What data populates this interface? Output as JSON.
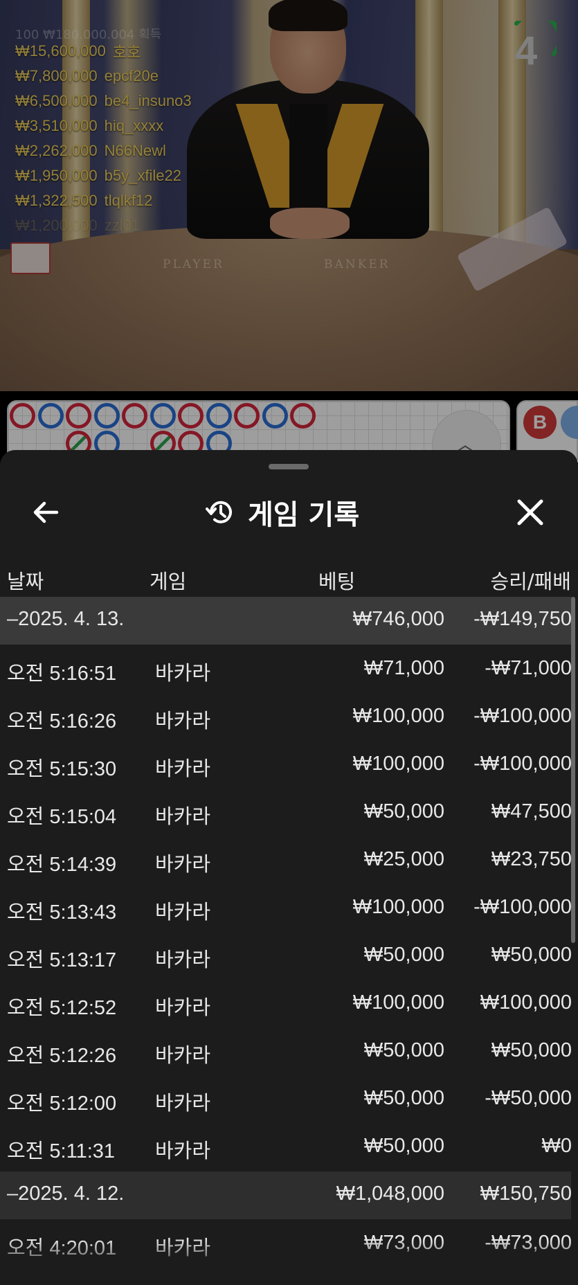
{
  "video": {
    "table_labels": {
      "player": "PLAYER",
      "banker": "BANKER"
    },
    "countdown": "4",
    "ticker_header": "100 ₩180,000,004 획득",
    "ticker": [
      {
        "amount": "₩15,600,000",
        "name": "호호"
      },
      {
        "amount": "₩7,800,000",
        "name": "epcf20e"
      },
      {
        "amount": "₩6,500,000",
        "name": "be4_insuno3"
      },
      {
        "amount": "₩3,510,000",
        "name": "hiq_xxxx"
      },
      {
        "amount": "₩2,262,000",
        "name": "N66Newl"
      },
      {
        "amount": "₩1,950,000",
        "name": "b5y_xfile22"
      },
      {
        "amount": "₩1,322,500",
        "name": "tlqlkf12"
      },
      {
        "amount": "₩1,200,000",
        "name": "zzl01"
      }
    ]
  },
  "roadmap": {
    "side_badge": "B",
    "colors": {
      "red": "#d7263d",
      "blue": "#2b6fd6",
      "green": "#2ea44f"
    }
  },
  "sheet": {
    "title": "게임 기록",
    "icons": {
      "back": "arrow-left-icon",
      "history": "history-icon",
      "close": "close-icon"
    },
    "columns": {
      "date": "날짜",
      "game": "게임",
      "bet": "베팅",
      "win_loss": "승리/패배"
    },
    "groups": [
      {
        "date": "–2025. 4. 13.",
        "bet": "₩746,000",
        "win_loss": "-₩149,750",
        "rows": [
          {
            "time": "오전 5:16:51",
            "game": "바카라",
            "bet": "₩71,000",
            "win_loss": "-₩71,000"
          },
          {
            "time": "오전 5:16:26",
            "game": "바카라",
            "bet": "₩100,000",
            "win_loss": "-₩100,000"
          },
          {
            "time": "오전 5:15:30",
            "game": "바카라",
            "bet": "₩100,000",
            "win_loss": "-₩100,000"
          },
          {
            "time": "오전 5:15:04",
            "game": "바카라",
            "bet": "₩50,000",
            "win_loss": "₩47,500"
          },
          {
            "time": "오전 5:14:39",
            "game": "바카라",
            "bet": "₩25,000",
            "win_loss": "₩23,750"
          },
          {
            "time": "오전 5:13:43",
            "game": "바카라",
            "bet": "₩100,000",
            "win_loss": "-₩100,000"
          },
          {
            "time": "오전 5:13:17",
            "game": "바카라",
            "bet": "₩50,000",
            "win_loss": "₩50,000"
          },
          {
            "time": "오전 5:12:52",
            "game": "바카라",
            "bet": "₩100,000",
            "win_loss": "₩100,000"
          },
          {
            "time": "오전 5:12:26",
            "game": "바카라",
            "bet": "₩50,000",
            "win_loss": "₩50,000"
          },
          {
            "time": "오전 5:12:00",
            "game": "바카라",
            "bet": "₩50,000",
            "win_loss": "-₩50,000"
          },
          {
            "time": "오전 5:11:31",
            "game": "바카라",
            "bet": "₩50,000",
            "win_loss": "₩0"
          }
        ]
      },
      {
        "date": "–2025. 4. 12.",
        "bet": "₩1,048,000",
        "win_loss": "₩150,750",
        "rows": [
          {
            "time": "오전 4:20:01",
            "game": "바카라",
            "bet": "₩73,000",
            "win_loss": "-₩73,000"
          }
        ]
      }
    ]
  }
}
